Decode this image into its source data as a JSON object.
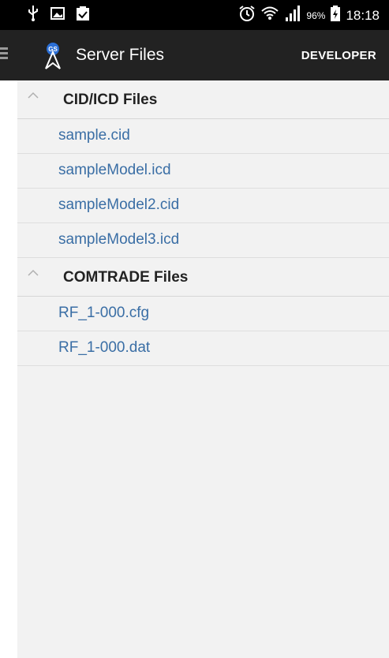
{
  "status_bar": {
    "battery_percent": "96%",
    "time": "18:18"
  },
  "toolbar": {
    "title": "Server Files",
    "developer_label": "DEVELOPER",
    "logo_badge": "GS"
  },
  "groups": [
    {
      "title": "CID/ICD Files",
      "files": [
        "sample.cid",
        "sampleModel.icd",
        "sampleModel2.cid",
        "sampleModel3.icd"
      ]
    },
    {
      "title": "COMTRADE Files",
      "files": [
        "RF_1-000.cfg",
        "RF_1-000.dat"
      ]
    }
  ],
  "colors": {
    "link": "#3a6ea5",
    "toolbar_bg": "#222222",
    "status_bg": "#000000",
    "list_bg": "#f2f2f2"
  }
}
